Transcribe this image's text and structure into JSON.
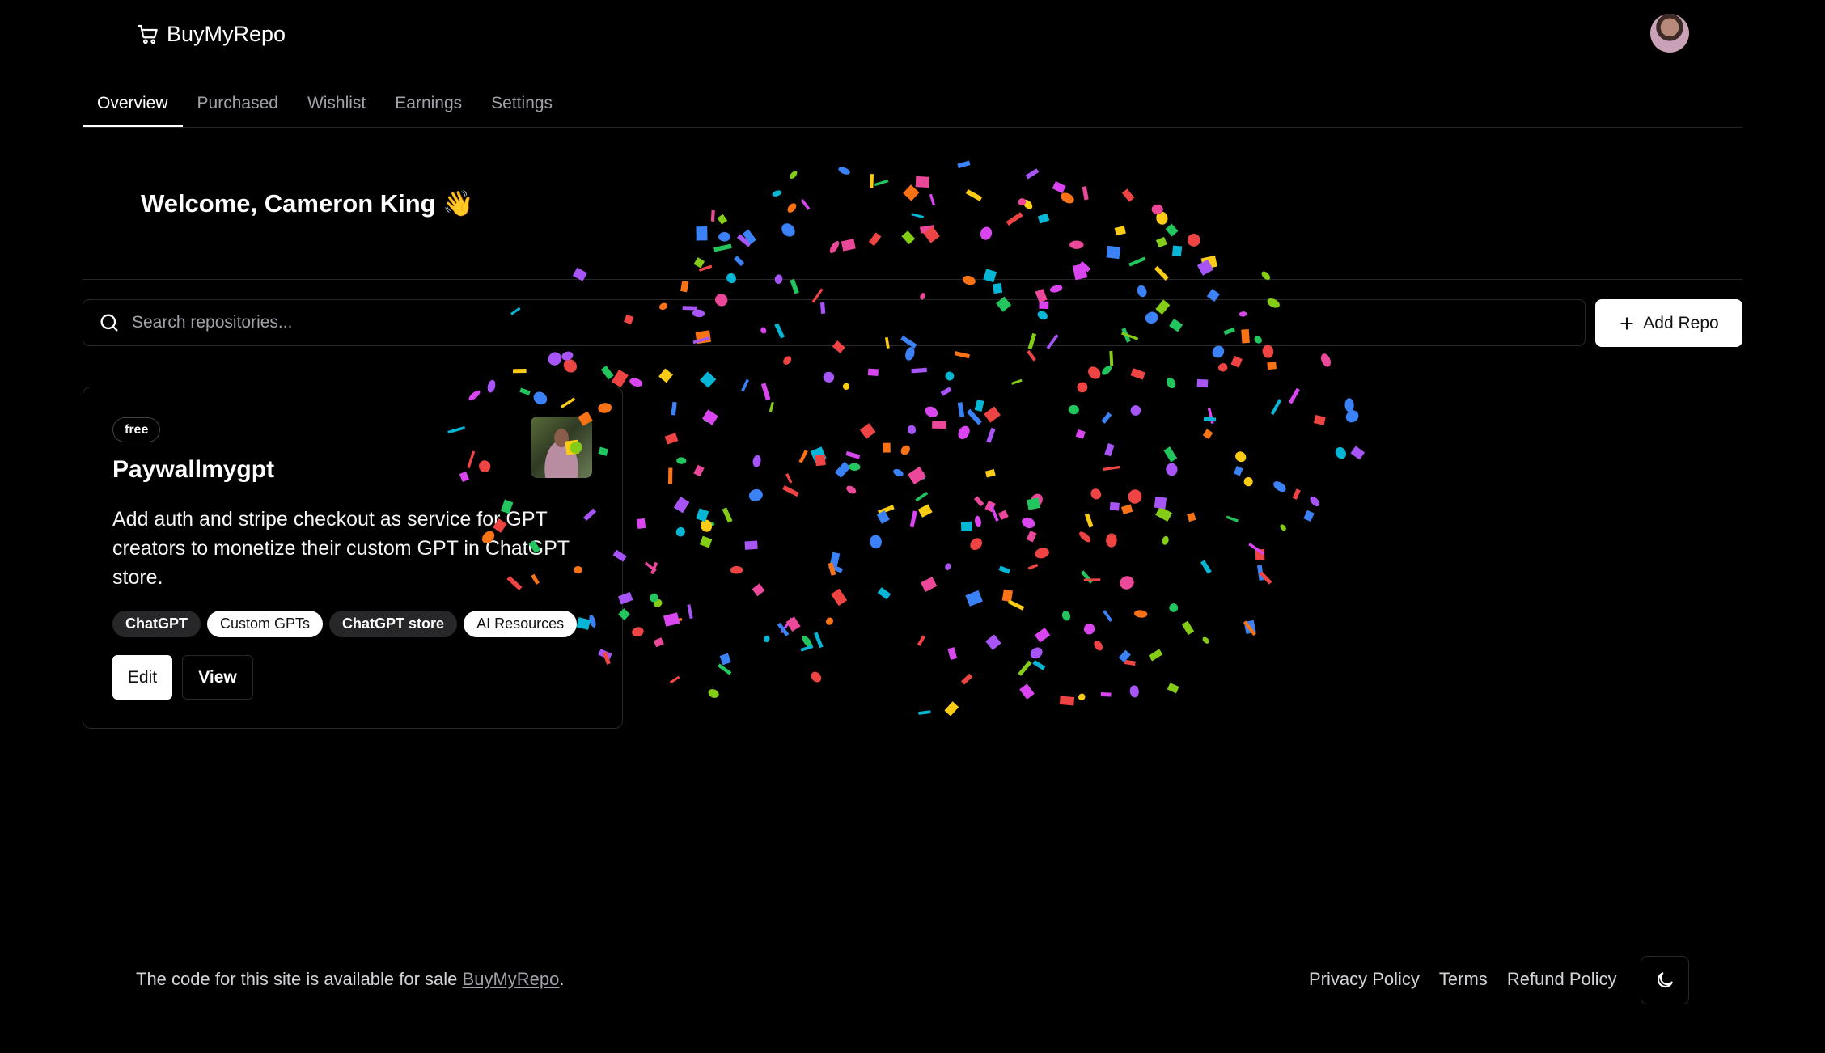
{
  "header": {
    "brand_icon": "cart-icon",
    "brand_name": "BuyMyRepo",
    "avatar_icon": "user-avatar"
  },
  "tabs": [
    {
      "label": "Overview",
      "active": true
    },
    {
      "label": "Purchased",
      "active": false
    },
    {
      "label": "Wishlist",
      "active": false
    },
    {
      "label": "Earnings",
      "active": false
    },
    {
      "label": "Settings",
      "active": false
    }
  ],
  "welcome": {
    "text": "Welcome, Cameron King 👋"
  },
  "search": {
    "icon": "search-icon",
    "placeholder": "Search repositories...",
    "value": ""
  },
  "add_repo": {
    "icon": "plus-icon",
    "label": "Add Repo"
  },
  "repo_card": {
    "badge": "free",
    "title": "Paywallmygpt",
    "description": "Add auth and stripe checkout as service for GPT creators to monetize their custom GPT in ChatGPT store.",
    "tags": [
      "ChatGPT",
      "Custom GPTs",
      "ChatGPT store",
      "AI Resources"
    ],
    "edit_label": "Edit",
    "view_label": "View"
  },
  "confetti_colors": [
    "#ec4899",
    "#a855f7",
    "#06b6d4",
    "#84cc16",
    "#facc15",
    "#f97316",
    "#ef4444",
    "#22c55e",
    "#3b82f6",
    "#d946ef"
  ],
  "footer": {
    "text_prefix": "The code for this site is available for sale ",
    "link_text": "BuyMyRepo",
    "text_suffix": ".",
    "links": [
      "Privacy Policy",
      "Terms",
      "Refund Policy"
    ],
    "theme_icon": "moon-icon"
  }
}
